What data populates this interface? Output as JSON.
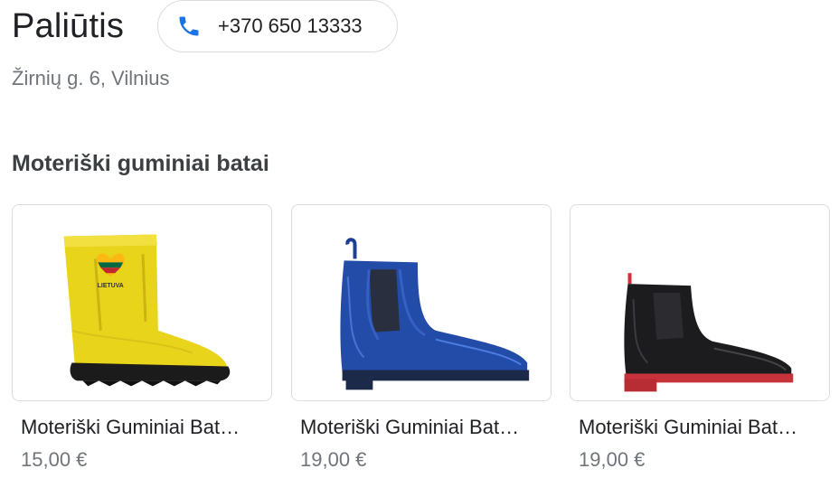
{
  "header": {
    "shop_name": "Paliūtis",
    "phone": "+370 650 13333",
    "address": "Žirnių g. 6, Vilnius"
  },
  "section": {
    "title": "Moteriški guminiai batai"
  },
  "products": [
    {
      "title": "Moteriški Guminiai Bat…",
      "price": "15,00 €",
      "image": "yellow-rubber-boot",
      "badge_text": "LIETUVA"
    },
    {
      "title": "Moteriški Guminiai Bat…",
      "price": "19,00 €",
      "image": "blue-chelsea-rubber-boot"
    },
    {
      "title": "Moteriški Guminiai Bat…",
      "price": "19,00 €",
      "image": "black-chelsea-rubber-boot"
    }
  ],
  "colors": {
    "accent_blue": "#1a73e8",
    "text_primary": "#202124",
    "text_secondary": "#70757a"
  },
  "icons": {
    "phone": "phone-icon"
  }
}
